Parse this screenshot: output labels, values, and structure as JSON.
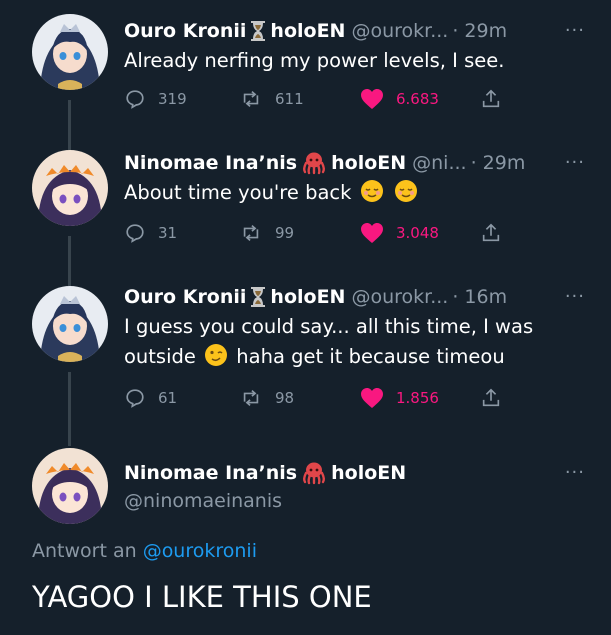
{
  "tweets": [
    {
      "name": "Ouro Kronii",
      "badge_icon": "hourglass-icon",
      "suffix": "holoEN",
      "handle": "@ourokr...",
      "time": "· 29m",
      "text_parts": [
        "Already nerfing my power levels, I see."
      ],
      "replies": "319",
      "retweets": "611",
      "likes": "6.683"
    },
    {
      "name": "Ninomae Ina’nis",
      "badge_icon": "octopus-icon",
      "suffix": "holoEN",
      "handle": "@ni...",
      "time": "· 29m",
      "text_parts": [
        "About time you're back"
      ],
      "replies": "31",
      "retweets": "99",
      "likes": "3.048"
    },
    {
      "name": "Ouro Kronii",
      "badge_icon": "hourglass-icon",
      "suffix": "holoEN",
      "handle": "@ourokr...",
      "time": "· 16m",
      "text_parts": [
        "I guess you could say... all this time, I was",
        "outside",
        "haha get it because timeou"
      ],
      "replies": "61",
      "retweets": "98",
      "likes": "1.856"
    }
  ],
  "focused": {
    "name": "Ninomae Ina’nis",
    "badge_icon": "octopus-icon",
    "suffix": "holoEN",
    "handle": "@ninomaeinanis",
    "reply_prefix": "Antwort an",
    "reply_handle": "@ourokronii",
    "text": "YAGOO I LIKE THIS ONE"
  },
  "more_label": "···",
  "colors": {
    "background": "#15202b",
    "secondary_text": "#8b98a5",
    "like_pink": "#f91880",
    "link_blue": "#1d9bf0",
    "thread_line": "#38444d"
  }
}
